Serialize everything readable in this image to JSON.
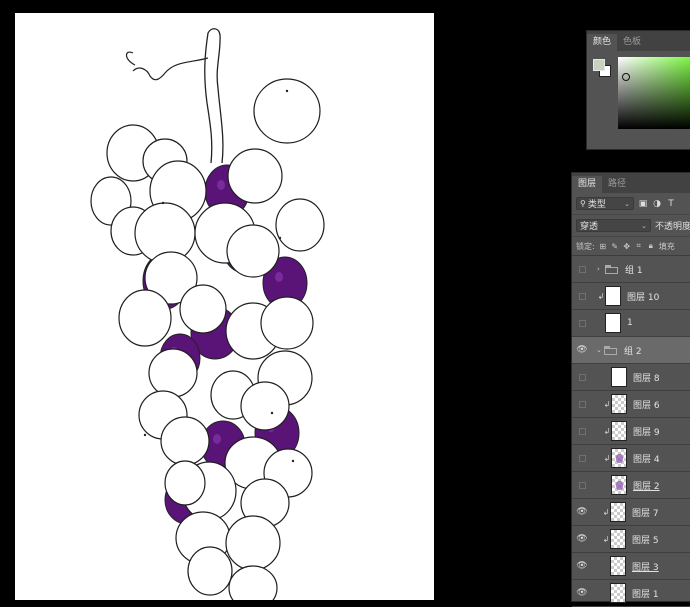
{
  "color_panel": {
    "tabs": [
      "颜色",
      "色板"
    ],
    "foreground_color": "#c7d3bf",
    "background_color": "#ffffff",
    "spectrum_hue": "#79f73e"
  },
  "layers_panel": {
    "tabs": [
      "图层",
      "路径"
    ],
    "filter_label": "类型",
    "blend_mode": "穿透",
    "opacity_label": "不透明度",
    "lock_label": "锁定:",
    "fill_label": "填充",
    "layers": [
      {
        "name": "组 1",
        "type": "group",
        "visible": false,
        "expanded": false,
        "clipped": false,
        "indent": 0
      },
      {
        "name": "图层 10",
        "type": "layer",
        "visible": false,
        "clipped": true,
        "indent": 0,
        "thumb": "plain"
      },
      {
        "name": "1",
        "type": "layer",
        "visible": false,
        "clipped": false,
        "indent": 0,
        "thumb": "plain"
      },
      {
        "name": "组 2",
        "type": "group",
        "visible": true,
        "expanded": true,
        "clipped": false,
        "indent": 0,
        "selected": true
      },
      {
        "name": "图层 8",
        "type": "layer",
        "visible": false,
        "clipped": false,
        "indent": 1,
        "thumb": "plain"
      },
      {
        "name": "图层 6",
        "type": "layer",
        "visible": false,
        "clipped": true,
        "indent": 1,
        "thumb": "checker"
      },
      {
        "name": "图层 9",
        "type": "layer",
        "visible": false,
        "clipped": true,
        "indent": 1,
        "thumb": "checker"
      },
      {
        "name": "图层 4",
        "type": "layer",
        "visible": false,
        "clipped": true,
        "indent": 1,
        "thumb": "purple"
      },
      {
        "name": "图层 2",
        "type": "layer",
        "visible": false,
        "clipped": false,
        "indent": 1,
        "thumb": "purple",
        "underlined": true
      },
      {
        "name": "图层 7",
        "type": "layer",
        "visible": true,
        "clipped": true,
        "indent": 1,
        "thumb": "checker"
      },
      {
        "name": "图层 5",
        "type": "layer",
        "visible": true,
        "clipped": true,
        "indent": 1,
        "thumb": "checker"
      },
      {
        "name": "图层 3",
        "type": "layer",
        "visible": true,
        "clipped": false,
        "indent": 1,
        "thumb": "checker",
        "underlined": true
      },
      {
        "name": "图层 1",
        "type": "layer",
        "visible": true,
        "clipped": false,
        "indent": 1,
        "thumb": "checker"
      }
    ]
  },
  "canvas": {
    "fill_color": "#5a1478",
    "highlight_color": "#8d3bb5"
  }
}
